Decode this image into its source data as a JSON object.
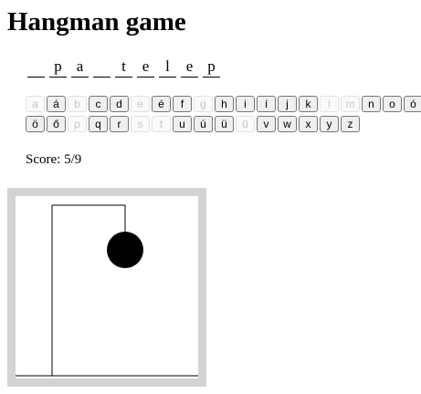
{
  "title": "Hangman game",
  "word": [
    "",
    "p",
    "a",
    "",
    "t",
    "e",
    "l",
    "e",
    "p"
  ],
  "keyboard": {
    "row1": [
      {
        "letter": "a",
        "used": true
      },
      {
        "letter": "á",
        "used": false
      },
      {
        "letter": "b",
        "used": true
      },
      {
        "letter": "c",
        "used": false
      },
      {
        "letter": "d",
        "used": false
      },
      {
        "letter": "e",
        "used": true
      },
      {
        "letter": "é",
        "used": false
      },
      {
        "letter": "f",
        "used": false
      },
      {
        "letter": "g",
        "used": true
      },
      {
        "letter": "h",
        "used": false
      },
      {
        "letter": "i",
        "used": false
      },
      {
        "letter": "í",
        "used": false
      },
      {
        "letter": "j",
        "used": false
      },
      {
        "letter": "k",
        "used": false
      },
      {
        "letter": "l",
        "used": true
      },
      {
        "letter": "m",
        "used": true
      },
      {
        "letter": "n",
        "used": false
      },
      {
        "letter": "o",
        "used": false
      },
      {
        "letter": "ó",
        "used": false
      }
    ],
    "row2": [
      {
        "letter": "ö",
        "used": false
      },
      {
        "letter": "ő",
        "used": false
      },
      {
        "letter": "p",
        "used": true
      },
      {
        "letter": "q",
        "used": false
      },
      {
        "letter": "r",
        "used": false
      },
      {
        "letter": "s",
        "used": true
      },
      {
        "letter": "t",
        "used": true
      },
      {
        "letter": "u",
        "used": false
      },
      {
        "letter": "ú",
        "used": false
      },
      {
        "letter": "ü",
        "used": false
      },
      {
        "letter": "ű",
        "used": true
      },
      {
        "letter": "v",
        "used": false
      },
      {
        "letter": "w",
        "used": false
      },
      {
        "letter": "x",
        "used": false
      },
      {
        "letter": "y",
        "used": false
      },
      {
        "letter": "z",
        "used": false
      }
    ]
  },
  "score": {
    "label": "Score:",
    "value": "5/9"
  },
  "colors": {
    "frame": "#d3d3d3",
    "drawing": "#000000"
  }
}
